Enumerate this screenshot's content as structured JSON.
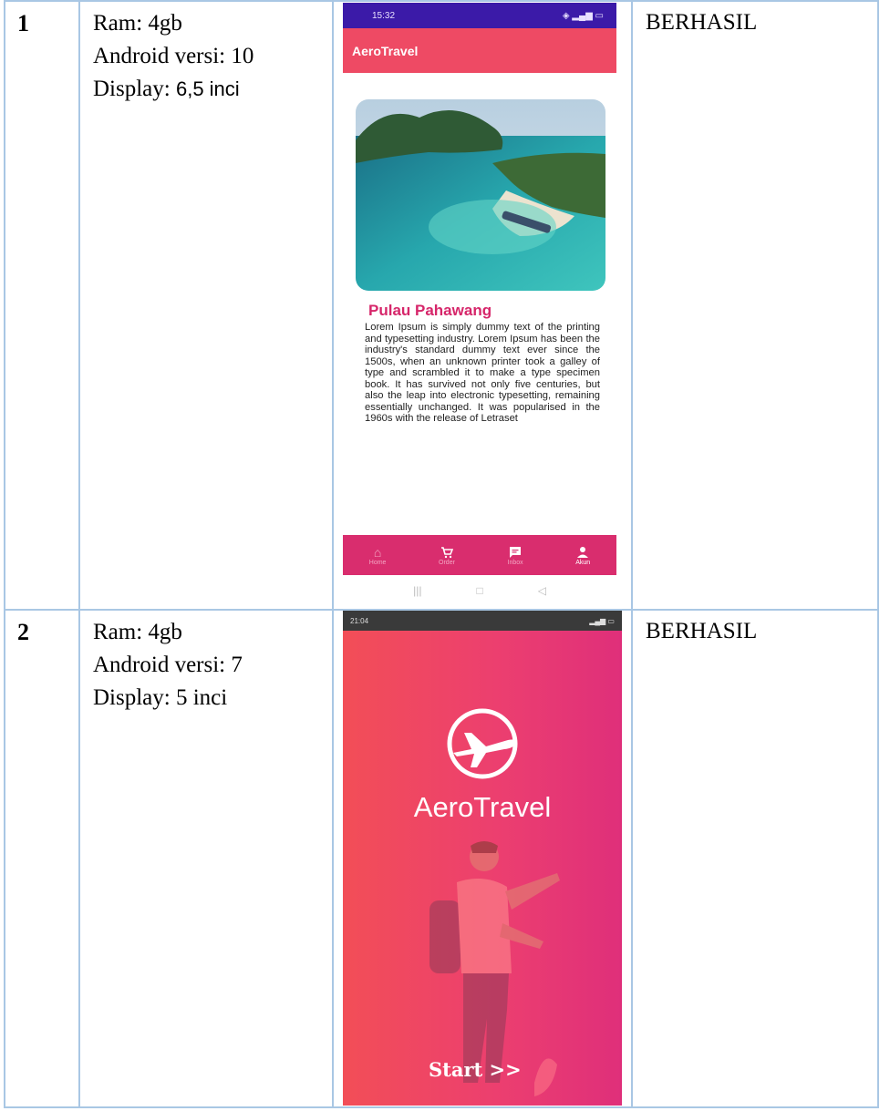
{
  "rows": [
    {
      "no": "1",
      "spec": {
        "ram": "Ram: 4gb",
        "android": "Android versi: 10",
        "display_label": "Display: ",
        "display_value": "6,5 inci"
      },
      "result": "BERHASIL",
      "phone": {
        "status_time": "15:32",
        "app_title": "AeroTravel",
        "destination_title": "Pulau Pahawang",
        "description": "Lorem Ipsum is simply dummy text of the printing and typesetting industry. Lorem Ipsum has been the industry's standard dummy text ever since the 1500s, when an unknown printer took a galley of type and scrambled it to make a type specimen book. It has survived not only five centuries, but also the leap into electronic typesetting, remaining essentially unchanged. It was popularised in the 1960s with the release of Letraset",
        "nav": [
          "Home",
          "Order",
          "Inbox",
          "Akun"
        ],
        "nav_icons": [
          "home-icon",
          "cart-icon",
          "chat-icon",
          "person-icon"
        ]
      }
    },
    {
      "no": "2",
      "spec": {
        "ram": "Ram: 4gb",
        "android": "Android versi: 7",
        "display": "Display: 5 inci"
      },
      "result": "BERHASIL",
      "phone": {
        "status_time": "21:04",
        "brand": "AeroTravel",
        "start_label": "Start >>"
      }
    }
  ],
  "colors": {
    "table_border": "#a9c7e4",
    "app_bar": "#ee4a64",
    "status_bar": "#3b1aa8",
    "accent_pink": "#d92d6e",
    "splash_start": "#f24e57",
    "splash_end": "#df2f7a"
  }
}
